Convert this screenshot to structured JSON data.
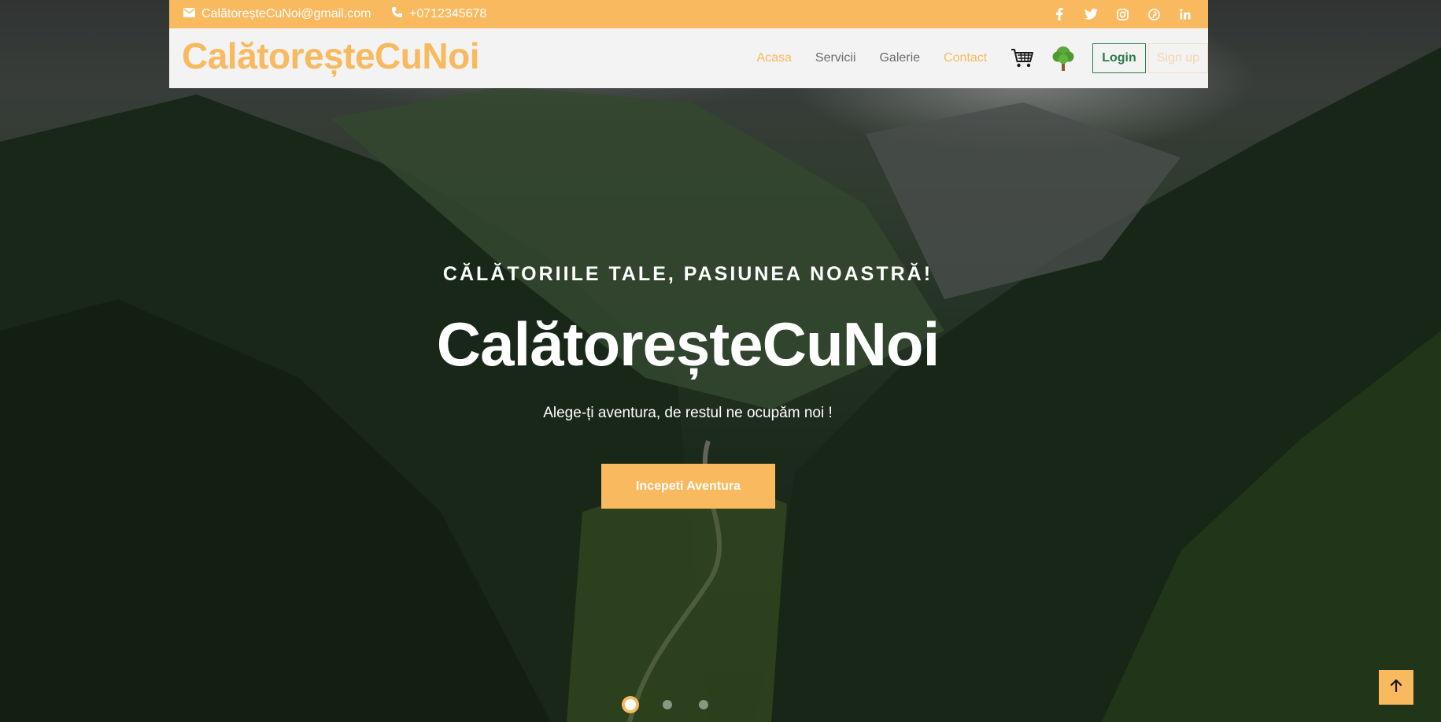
{
  "topbar": {
    "email": "CalătoreșteCuNoi@gmail.com",
    "phone": "+0712345678",
    "socials": [
      "facebook-icon",
      "twitter-icon",
      "instagram-icon",
      "pinterest-icon",
      "linkedin-icon"
    ]
  },
  "navbar": {
    "brand": "CalătoreșteCuNoi",
    "links": [
      {
        "label": "Acasa",
        "active": true
      },
      {
        "label": "Servicii",
        "active": false
      },
      {
        "label": "Galerie",
        "active": false
      },
      {
        "label": "Contact",
        "active": true
      }
    ],
    "icons": [
      "cart-icon",
      "tree-icon"
    ],
    "login_label": "Login",
    "signup_label": "Sign up"
  },
  "hero": {
    "subtitle": "CĂLĂTORIILE TALE, PASIUNEA NOASTRĂ!",
    "title": "CalătoreșteCuNoi",
    "description": "Alege-ți aventura, de restul ne ocupăm noi !",
    "cta_label": "Incepeti Aventura"
  },
  "carousel": {
    "slides": 3,
    "active_index": 0
  },
  "colors": {
    "accent": "#f9b95f",
    "login_green": "#2e7a4a",
    "nav_bg": "#f3f3f3"
  }
}
